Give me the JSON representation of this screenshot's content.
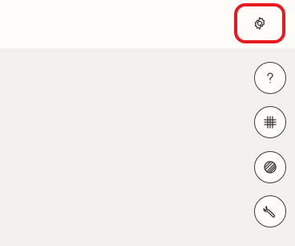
{
  "header": {
    "settings_icon": "gear-icon",
    "highlight_color": "#e8191f",
    "background": "#fdfcf8"
  },
  "toolbar": {
    "buttons": [
      {
        "name": "help",
        "icon": "question-mark-icon"
      },
      {
        "name": "grid",
        "icon": "grid-icon"
      },
      {
        "name": "texture",
        "icon": "hatched-circle-icon"
      },
      {
        "name": "tools",
        "icon": "wrench-icon"
      }
    ]
  },
  "canvas": {
    "background": "#f2f1f0"
  }
}
